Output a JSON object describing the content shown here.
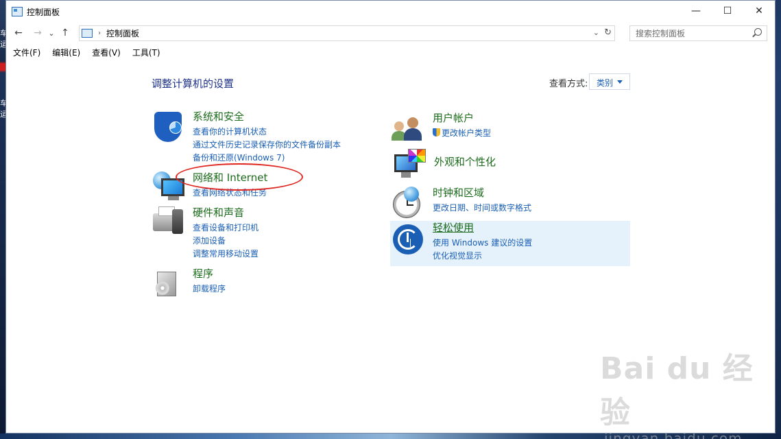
{
  "window": {
    "title": "控制面板",
    "controls": {
      "minimize": "—",
      "maximize": "☐",
      "close": "✕"
    }
  },
  "nav": {
    "back": "←",
    "forward": "→",
    "recent": "⌄",
    "up": "↑",
    "breadcrumb_sep": "›",
    "breadcrumb": "控制面板",
    "dropdown": "⌄",
    "refresh": "↻"
  },
  "search": {
    "placeholder": "搜索控制面板"
  },
  "menu": {
    "items": [
      "文件(F)",
      "编辑(E)",
      "查看(V)",
      "工具(T)"
    ]
  },
  "main": {
    "heading": "调整计算机的设置",
    "view_by_label": "查看方式:",
    "view_by_value": "类别",
    "categories": [
      {
        "title": "系统和安全",
        "icon": "shield-icon",
        "links": [
          "查看你的计算机状态",
          "通过文件历史记录保存你的文件备份副本",
          "备份和还原(Windows 7)"
        ]
      },
      {
        "title": "网络和 Internet",
        "icon": "network-icon",
        "links": [
          "查看网络状态和任务"
        ]
      },
      {
        "title": "硬件和声音",
        "icon": "printer-icon",
        "links": [
          "查看设备和打印机",
          "添加设备",
          "调整常用移动设置"
        ]
      },
      {
        "title": "程序",
        "icon": "programs-icon",
        "links": [
          "卸载程序"
        ]
      },
      {
        "title": "用户帐户",
        "icon": "users-icon",
        "links": [
          "更改帐户类型"
        ]
      },
      {
        "title": "外观和个性化",
        "icon": "appearance-icon",
        "links": []
      },
      {
        "title": "时钟和区域",
        "icon": "clock-icon",
        "links": [
          "更改日期、时间或数字格式"
        ]
      },
      {
        "title": "轻松使用",
        "icon": "ease-of-access-icon",
        "links": [
          "使用 Windows 建议的设置",
          "优化视觉显示"
        ]
      }
    ]
  },
  "desktop": {
    "left_glyphs": [
      "车",
      "运",
      "车",
      "运"
    ]
  },
  "watermark": {
    "brand": "Bai du 经验",
    "url": "jingyan.baidu.com"
  },
  "colors": {
    "category_title": "#1b6b1b",
    "link": "#1a5fb4",
    "heading": "#1e3287",
    "highlight": "#e5f1fb",
    "annotation": "#e0251f"
  }
}
